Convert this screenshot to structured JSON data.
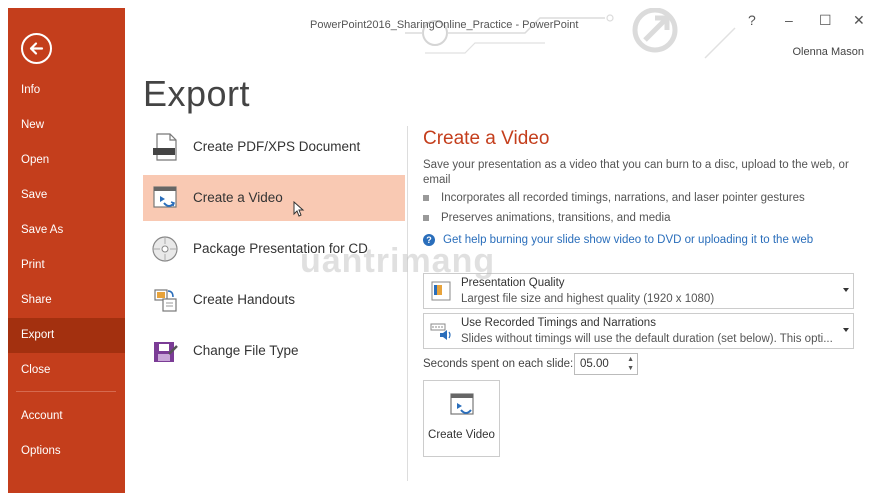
{
  "window": {
    "title": "PowerPoint2016_SharingOnline_Practice - PowerPoint",
    "user": "Olenna Mason",
    "controls": [
      "?",
      "–",
      "☐",
      "✕"
    ]
  },
  "sidebar": {
    "items": [
      {
        "label": "Info"
      },
      {
        "label": "New"
      },
      {
        "label": "Open"
      },
      {
        "label": "Save"
      },
      {
        "label": "Save As"
      },
      {
        "label": "Print"
      },
      {
        "label": "Share"
      },
      {
        "label": "Export"
      },
      {
        "label": "Close"
      },
      {
        "label": "Account"
      },
      {
        "label": "Options"
      }
    ],
    "active": "Export",
    "color": "#c43e1c"
  },
  "page_title": "Export",
  "export_options": [
    {
      "label": "Create PDF/XPS Document",
      "icon": "pdf-document-icon"
    },
    {
      "label": "Create a Video",
      "icon": "video-icon",
      "selected": true
    },
    {
      "label": "Package Presentation for CD",
      "icon": "cd-icon"
    },
    {
      "label": "Create Handouts",
      "icon": "handouts-icon"
    },
    {
      "label": "Change File Type",
      "icon": "file-type-icon"
    }
  ],
  "detail": {
    "heading": "Create a Video",
    "description": "Save your presentation as a video that you can burn to a disc, upload to the web, or email",
    "bullets": [
      "Incorporates all recorded timings, narrations, and laser pointer gestures",
      "Preserves animations, transitions, and media"
    ],
    "help_link": "Get help burning your slide show video to DVD or uploading it to the web",
    "quality": {
      "title": "Presentation Quality",
      "subtitle": "Largest file size and highest quality (1920 x 1080)"
    },
    "timings": {
      "title": "Use Recorded Timings and Narrations",
      "subtitle": "Slides without timings will use the default duration (set below). This opti..."
    },
    "seconds_label": "Seconds spent on each slide:",
    "seconds_value": "05.00",
    "create_button": "Create Video"
  },
  "watermark": "uantrimang"
}
